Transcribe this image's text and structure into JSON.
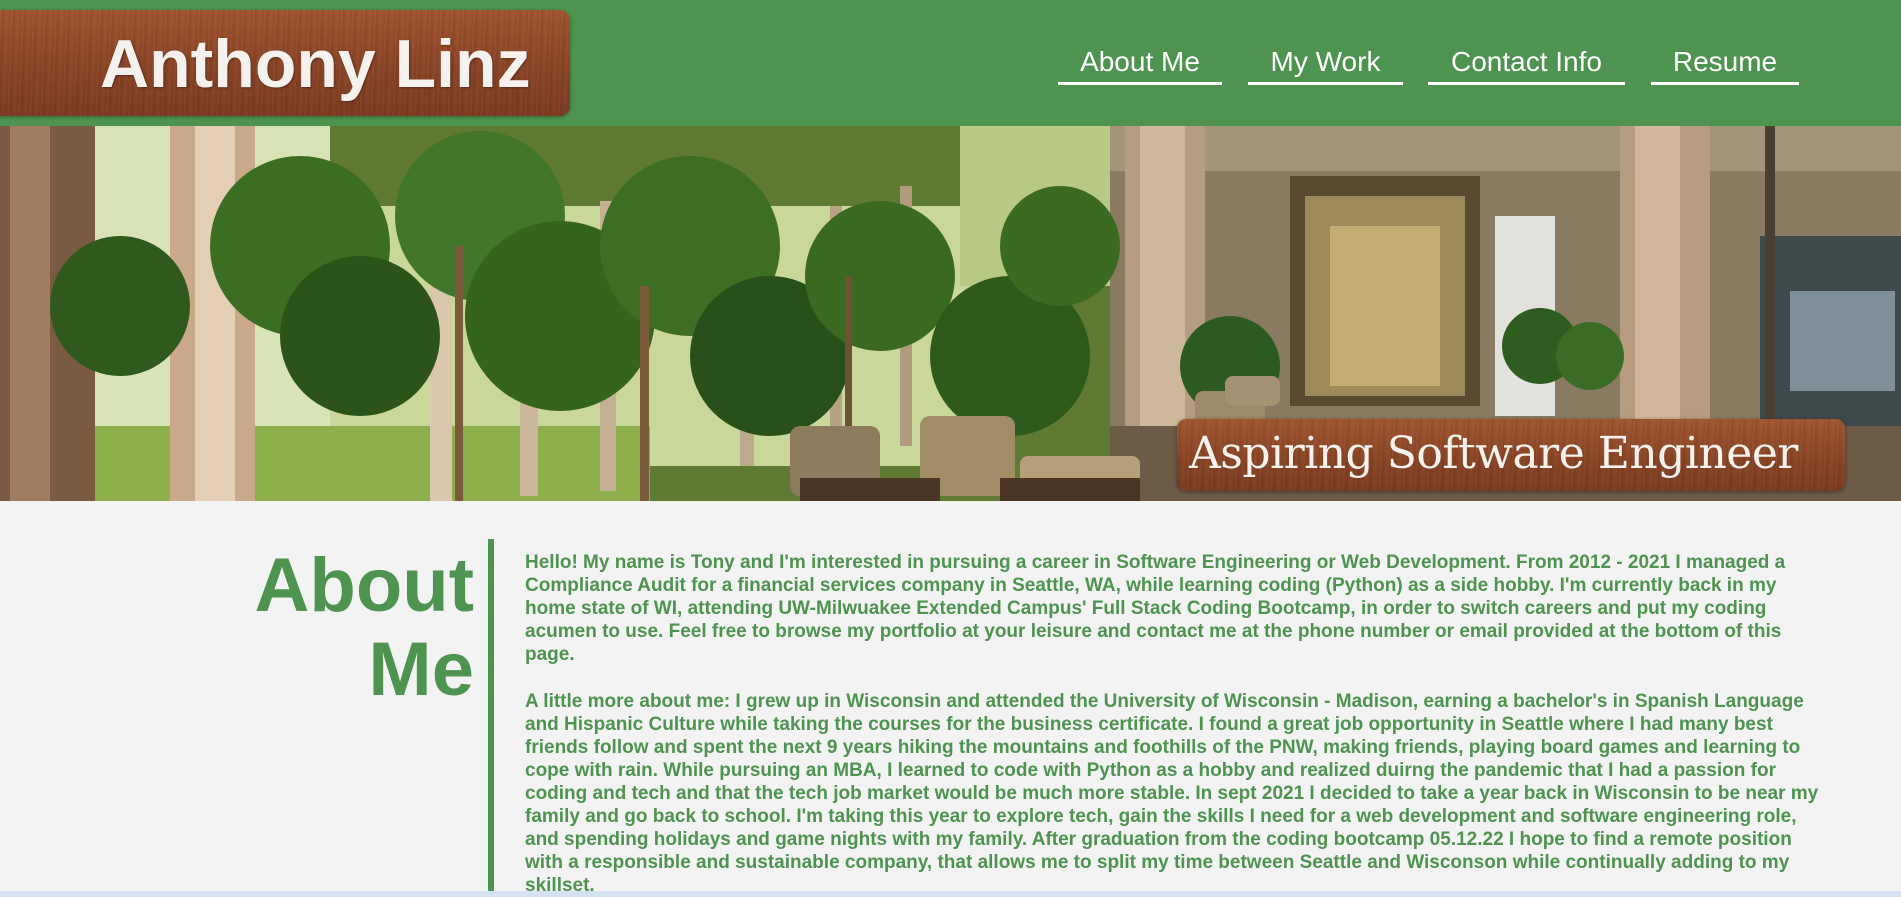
{
  "header": {
    "logo_text": "Anthony Linz",
    "nav": [
      {
        "label": "About Me"
      },
      {
        "label": "My Work"
      },
      {
        "label": "Contact Info"
      },
      {
        "label": "Resume"
      }
    ]
  },
  "hero": {
    "tagline": "Aspiring Software Engineer",
    "image_icon": "atrium-photo"
  },
  "about": {
    "title": "About Me",
    "paragraphs": [
      "Hello! My name is Tony and I'm interested in pursuing a career in Software Engineering or Web Development. From 2012 - 2021 I managed a Compliance Audit for a financial services company in Seattle, WA, while learning coding (Python) as a side hobby. I'm currently back in my home state of WI, attending UW-Milwuakee Extended Campus' Full Stack Coding Bootcamp, in order to switch careers and put my coding acumen to use. Feel free to browse my portfolio at your leisure and contact me at the phone number or email provided at the bottom of this page.",
      "A little more about me: I grew up in Wisconsin and attended the University of Wisconsin - Madison, earning a bachelor's in Spanish Language and Hispanic Culture while taking the courses for the business certificate. I found a great job opportunity in Seattle where I had many best friends follow and spent the next 9 years hiking the mountains and foothills of the PNW, making friends, playing board games and learning to cope with rain. While pursuing an MBA, I learned to code with Python as a hobby and realized duirng the pandemic that I had a passion for coding and tech and that the tech job market would be much more stable. In sept 2021 I decided to take a year back in Wisconsin to be near my family and go back to school. I'm taking this year to explore tech, gain the skills I need for a web development and software engineering role, and spending holidays and game nights with my family. After graduation from the coding bootcamp 05.12.22 I hope to find a remote position with a responsible and sustainable company, that allows me to split my time between Seattle and Wisconson while continually adding to my skillset."
    ]
  },
  "colors": {
    "brand_green": "#4e9350",
    "wood": "#8e4526",
    "background": "#f3f3f3"
  }
}
